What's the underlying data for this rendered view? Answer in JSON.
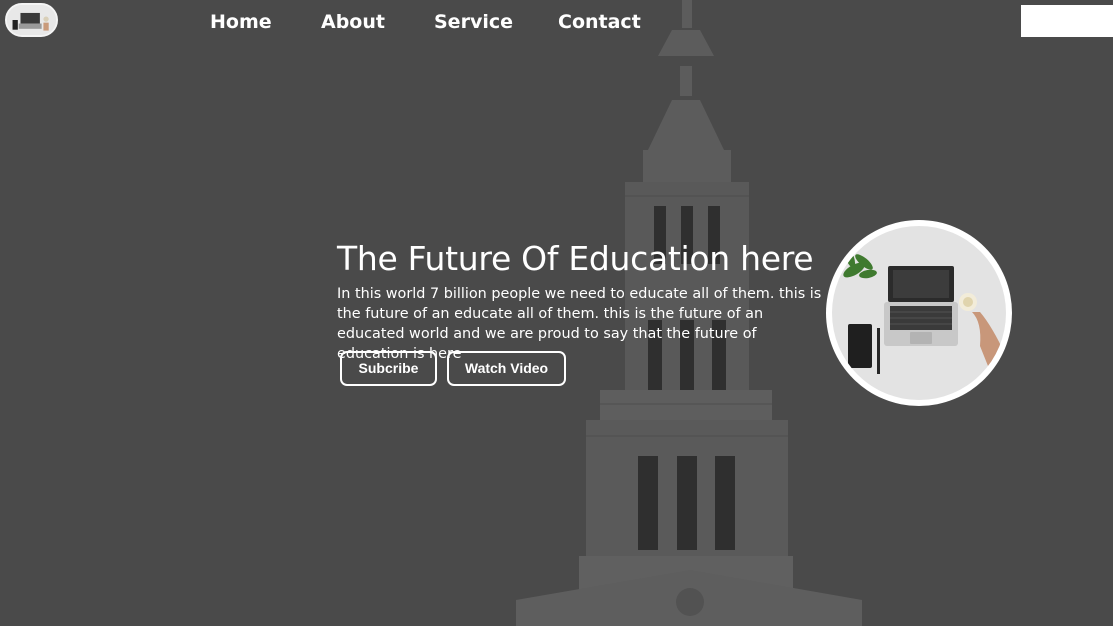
{
  "nav": {
    "logo_icon": "laptop-desk-icon",
    "items": [
      {
        "label": "Home"
      },
      {
        "label": "About"
      },
      {
        "label": "Service"
      },
      {
        "label": "Contact"
      }
    ],
    "search": {
      "value": "",
      "placeholder": ""
    }
  },
  "hero": {
    "title": "The Future Of Education here",
    "text": "In this world 7 billion people we need to educate all of them. this is the future of an educate all of them. this is the future of an educated world and we are proud to say that the future of education is here",
    "buttons": {
      "subscribe": "Subcribe",
      "watch_video": "Watch Video"
    },
    "image_icon": "laptop-desk-photo"
  },
  "colors": {
    "overlay": "#4a4a4a",
    "text": "#ffffff",
    "button_border": "#ffffff"
  }
}
